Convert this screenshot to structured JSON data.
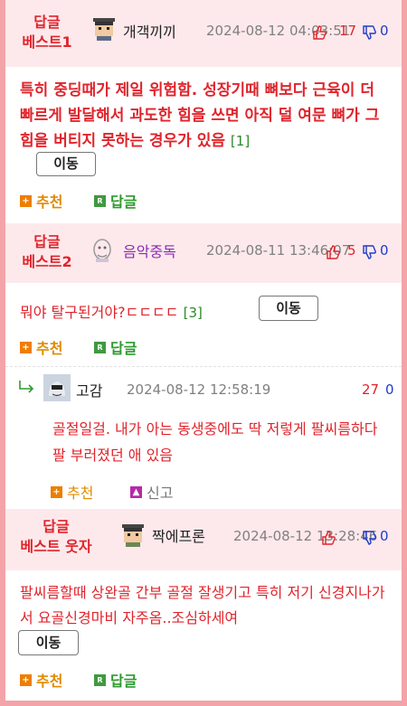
{
  "colors": {
    "accent_red": "#e0242c",
    "header_bg": "#fde9eb",
    "frame": "#f4a4a8",
    "down_blue": "#1e3cc8",
    "recommend": "#e08b00",
    "reply": "#2e9a2e"
  },
  "labels": {
    "recommend": "추천",
    "reply": "답글",
    "report": "신고",
    "move": "이동"
  },
  "posts": [
    {
      "rank_line1": "답글",
      "rank_line2": "베스트1",
      "nickname": "개객끼끼",
      "date": "2024-08-12 04:03:51",
      "up": "17",
      "down": "0",
      "body": "특히 중딩때가 제일 위험함. 성장기때 뼈보다 근육이 더 빠르게 발달해서 과도한 힘을 쓰면 아직 덜 여문 뼈가 그 힘을 버티지 못하는 경우가 있음",
      "count": "[1]"
    },
    {
      "rank_line1": "답글",
      "rank_line2": "베스트2",
      "nickname": "음악중독",
      "date": "2024-08-11 13:46:07",
      "up": "5",
      "down": "0",
      "body": "뭐야 탈구된거야?ㄷㄷㄷㄷ",
      "count": "[3]"
    },
    {
      "rank_line1": "답글",
      "rank_line2": "베스트 웃자",
      "nickname": "짝에프론",
      "date": "2024-08-12 13:28:46",
      "up": "",
      "down": "0",
      "body": "팔씨름할때 상완골 간부 골절 잘생기고 특히 저기 신경지나가서 요골신경마비 자주옴..조심하세여"
    }
  ],
  "reply": {
    "nickname": "고감",
    "date": "2024-08-12 12:58:19",
    "up": "27",
    "down": "0",
    "body": "골절일걸. 내가 아는 동생중에도 딱 저렇게 팔씨름하다 팔 부러졌던 애 있음"
  },
  "icons": [
    "thumbs-up-icon",
    "thumbs-down-icon",
    "reply-arrow-icon",
    "plus-icon",
    "reply-r-icon",
    "report-icon"
  ]
}
